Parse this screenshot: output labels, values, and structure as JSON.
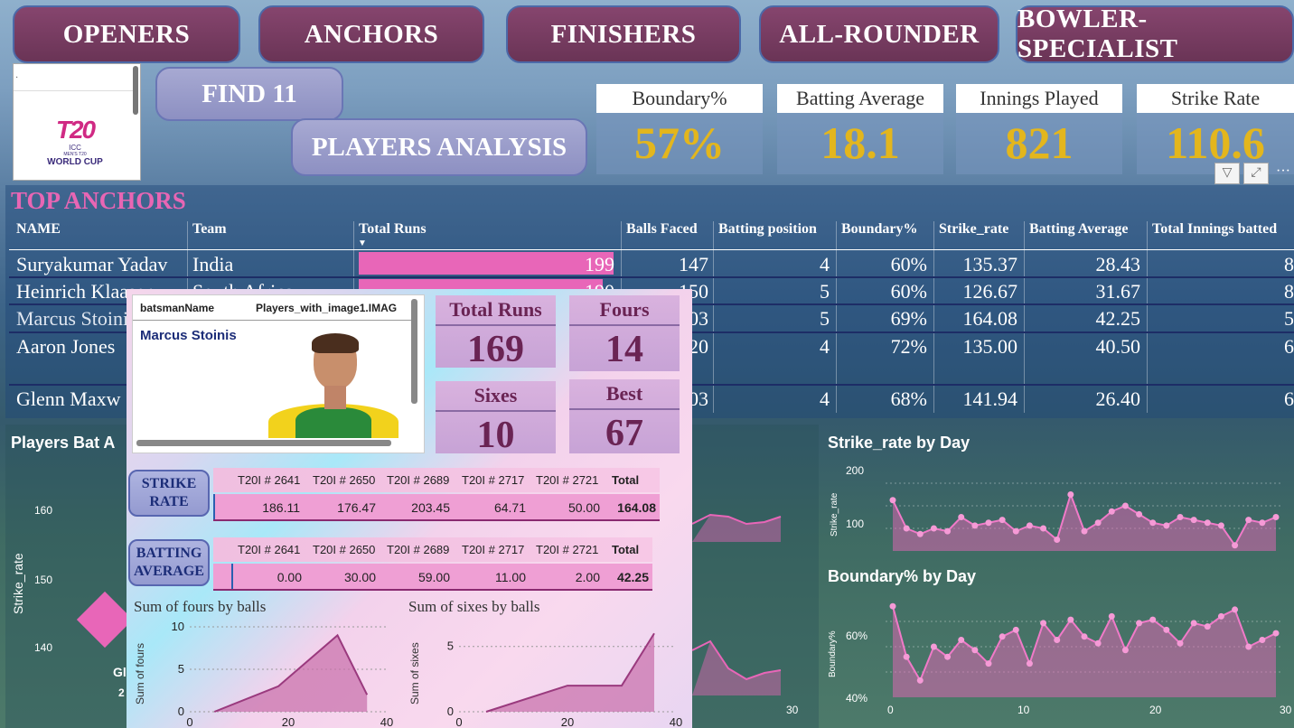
{
  "nav": {
    "openers": "OPENERS",
    "anchors": "ANCHORS",
    "finishers": "FINISHERS",
    "allrounder": "ALL-ROUNDER",
    "bowler": "BOWLER-SPECIALIST"
  },
  "sub_nav": {
    "find11": "FIND 11",
    "analysis": "PLAYERS ANALYSIS"
  },
  "logo": {
    "line1": "ICC",
    "line2": "MEN'S T20",
    "line3": "WORLD CUP",
    "mark": "T20"
  },
  "kpis": [
    {
      "label": "Boundary%",
      "value": "57%"
    },
    {
      "label": "Batting Average",
      "value": "18.1"
    },
    {
      "label": "Innings Played",
      "value": "821"
    },
    {
      "label": "Strike Rate",
      "value": "110.6"
    }
  ],
  "table": {
    "title": "TOP ANCHORS",
    "headers": [
      "NAME",
      "Team",
      "Total Runs",
      "Balls Faced",
      "Batting position",
      "Boundary%",
      "Strike_rate",
      "Batting Average",
      "Total Innings batted"
    ],
    "rows": [
      {
        "name": "Suryakumar Yadav",
        "team": "India",
        "runs": "199",
        "balls": "147",
        "pos": "4",
        "bnd": "60%",
        "sr": "135.37",
        "avg": "28.43",
        "inn": "8"
      },
      {
        "name": "Heinrich Klaasen",
        "team": "South Africa",
        "runs": "190",
        "balls": "150",
        "pos": "5",
        "bnd": "60%",
        "sr": "126.67",
        "avg": "31.67",
        "inn": "8"
      },
      {
        "name": "Marcus Stoinis",
        "team": "",
        "runs": "",
        "balls": "03",
        "pos": "5",
        "bnd": "69%",
        "sr": "164.08",
        "avg": "42.25",
        "inn": "5"
      },
      {
        "name": "Aaron Jones",
        "team": "",
        "runs": "",
        "balls": "20",
        "pos": "4",
        "bnd": "72%",
        "sr": "135.00",
        "avg": "40.50",
        "inn": "6"
      },
      {
        "name": "Glenn Maxw",
        "team": "",
        "runs": "",
        "balls": "03",
        "pos": "4",
        "bnd": "68%",
        "sr": "141.94",
        "avg": "26.40",
        "inn": "6"
      }
    ]
  },
  "tooltip": {
    "col1": "batsmanName",
    "col2": "Players_with_image1.IMAG",
    "player": "Marcus Stoinis",
    "stats": [
      {
        "label": "Total Runs",
        "value": "169"
      },
      {
        "label": "Fours",
        "value": "14"
      },
      {
        "label": "Sixes",
        "value": "10"
      },
      {
        "label": "Best",
        "value": "67"
      }
    ],
    "matches": [
      "T20I # 2641",
      "T20I # 2650",
      "T20I # 2689",
      "T20I # 2717",
      "T20I # 2721",
      "Total"
    ],
    "strike_label": "STRIKE RATE",
    "strike": [
      "186.11",
      "176.47",
      "203.45",
      "64.71",
      "50.00",
      "164.08"
    ],
    "avg_label": "BATTING AVERAGE",
    "avg": [
      "0.00",
      "30.00",
      "59.00",
      "11.00",
      "2.00",
      "42.25"
    ],
    "fours_title": "Sum of fours by balls",
    "fours_ylabel": "Sum of fours",
    "sixes_title": "Sum of sixes by balls",
    "sixes_ylabel": "Sum of sixes"
  },
  "background_charts": {
    "bat_title": "Players Bat A",
    "bat_ylabel": "Strike_rate",
    "bat_ticks": [
      "160",
      "150",
      "140"
    ],
    "sr_title": "Strike_rate by Day",
    "sr_ylabel": "Strike_rate",
    "sr_ticks": [
      "200",
      "100"
    ],
    "bnd_title": "Boundary% by Day",
    "bnd_ylabel": "Boundary%",
    "bnd_ticks": [
      "60%",
      "40%"
    ],
    "x_ticks": [
      "0",
      "10",
      "20",
      "30"
    ],
    "mid_x": "30",
    "partial_labels": [
      "Gl",
      "2"
    ]
  },
  "chart_data": [
    {
      "type": "area",
      "title": "Sum of fours by balls",
      "xlabel": "",
      "ylabel": "Sum of fours",
      "x": [
        5,
        18,
        30,
        36
      ],
      "values": [
        0,
        3,
        9,
        2
      ],
      "xlim": [
        0,
        40
      ],
      "ylim": [
        0,
        10
      ]
    },
    {
      "type": "area",
      "title": "Sum of sixes by balls",
      "xlabel": "",
      "ylabel": "Sum of sixes",
      "x": [
        5,
        20,
        30,
        36
      ],
      "values": [
        0,
        2,
        2,
        6
      ],
      "xlim": [
        0,
        40
      ],
      "ylim": [
        0,
        6.5
      ]
    },
    {
      "type": "area",
      "title": "Strike_rate by Day",
      "ylabel": "Strike_rate",
      "x": [
        1,
        2,
        3,
        4,
        5,
        6,
        7,
        8,
        9,
        10,
        11,
        12,
        13,
        14,
        15,
        16,
        17,
        18,
        19,
        20,
        21,
        22,
        23,
        24,
        25,
        26,
        27,
        28,
        29
      ],
      "values": [
        150,
        100,
        90,
        100,
        95,
        120,
        105,
        110,
        115,
        95,
        105,
        100,
        80,
        160,
        95,
        110,
        130,
        140,
        125,
        110,
        105,
        120,
        115,
        110,
        105,
        70,
        115,
        110,
        120
      ],
      "ylim": [
        60,
        220
      ]
    },
    {
      "type": "area",
      "title": "Boundary% by Day",
      "ylabel": "Boundary%",
      "x": [
        1,
        2,
        3,
        4,
        5,
        6,
        7,
        8,
        9,
        10,
        11,
        12,
        13,
        14,
        15,
        16,
        17,
        18,
        19,
        20,
        21,
        22,
        23,
        24,
        25,
        26,
        27,
        28,
        29
      ],
      "values": [
        67,
        52,
        45,
        55,
        52,
        57,
        54,
        50,
        58,
        60,
        50,
        62,
        57,
        63,
        58,
        56,
        64,
        54,
        62,
        63,
        60,
        56,
        62,
        61,
        64,
        66,
        55,
        57,
        59
      ],
      "ylim": [
        40,
        70
      ]
    }
  ]
}
